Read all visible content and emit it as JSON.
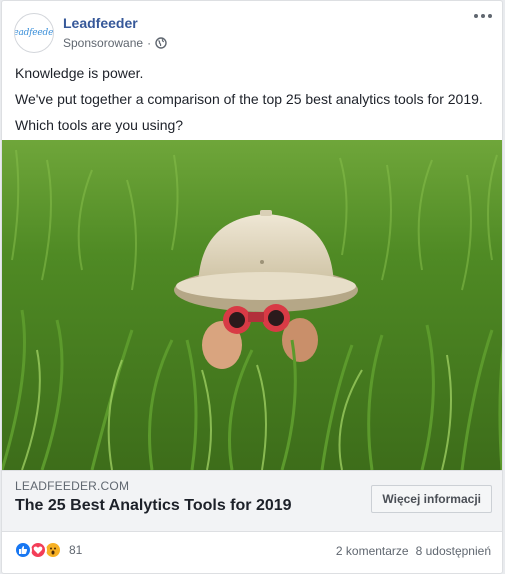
{
  "post": {
    "page_name": "Leadfeeder",
    "avatar_logo_text": "leadfeeder",
    "sponsored_label": "Sponsorowane",
    "separator": "·",
    "body_lines": [
      "Knowledge is power.",
      "We've put together a comparison of the top 25 best analytics tools for 2019.",
      "Which tools are you using?"
    ]
  },
  "link_preview": {
    "domain": "LEADFEEDER.COM",
    "title": "The 25 Best Analytics Tools for 2019",
    "cta_label": "Więcej informacji"
  },
  "engagement": {
    "reaction_icons": [
      "like-icon",
      "love-icon",
      "wow-icon"
    ],
    "reaction_count": "81",
    "comments": "2 komentarze",
    "shares": "8 udostępnień"
  },
  "colors": {
    "page_name": "#365899",
    "like": "#1877f2",
    "love": "#f33e58",
    "wow": "#f7b125",
    "link_box_bg": "#f2f3f5"
  }
}
